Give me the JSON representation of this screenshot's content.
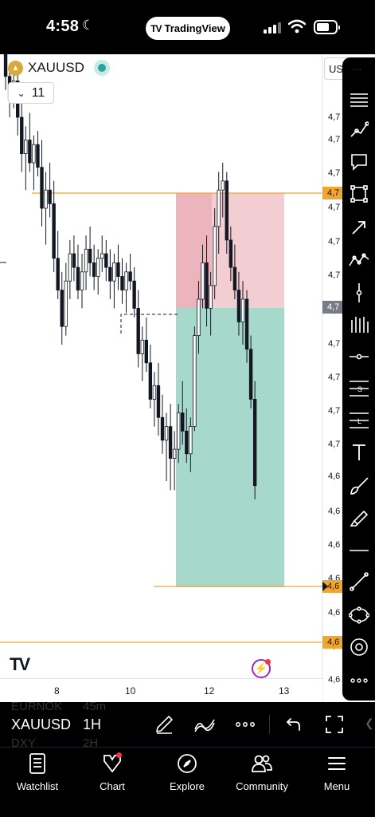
{
  "status_bar": {
    "time": "4:58",
    "app_pill": "TradingView"
  },
  "header": {
    "symbol": "XAUUSD",
    "indicator_count": "11",
    "currency_label": "USD"
  },
  "price_axis": {
    "labels": [
      "4,7",
      "4,7",
      "4,7",
      "4,7",
      "4,7",
      "4,7",
      "4,7",
      "4,7",
      "4,7",
      "4,7",
      "4,7",
      "4,6",
      "4,6",
      "4,6",
      "4,6",
      "4,6",
      "4,6",
      "4,6"
    ],
    "tags": [
      {
        "label": "4,7",
        "kind": "stop"
      },
      {
        "label": "4,7",
        "kind": "current"
      },
      {
        "label": "4,6",
        "kind": "target"
      },
      {
        "label": "4,6",
        "kind": "level"
      }
    ]
  },
  "time_axis": {
    "labels": [
      "8",
      "10",
      "12",
      "13"
    ]
  },
  "symbol_bar": {
    "symbol": "XAUUSD",
    "interval": "1H",
    "ghost_symbols": [
      "EURNOK",
      "DXY"
    ],
    "ghost_intervals": [
      "45m",
      "2H"
    ]
  },
  "nav": {
    "items": [
      {
        "label": "Watchlist",
        "icon": "watchlist-icon"
      },
      {
        "label": "Chart",
        "icon": "chart-icon"
      },
      {
        "label": "Explore",
        "icon": "compass-icon"
      },
      {
        "label": "Community",
        "icon": "community-icon"
      },
      {
        "label": "Menu",
        "icon": "menu-icon"
      }
    ]
  },
  "colors": {
    "up_candle": "#ffffff",
    "candle_border": "#131722",
    "stop_zone": "#f2cdd2",
    "target_zone": "#a6d8cc",
    "level_line": "#f0a730",
    "accent": "#2962ff"
  },
  "candles": [
    [
      0,
      80,
      82,
      74,
      76
    ],
    [
      1,
      75,
      76,
      66,
      69
    ],
    [
      2,
      69,
      71,
      60,
      64
    ],
    [
      3,
      64,
      70,
      62,
      68
    ],
    [
      4,
      68,
      72,
      56,
      60
    ],
    [
      5,
      60,
      64,
      48,
      52
    ],
    [
      6,
      52,
      58,
      44,
      55
    ],
    [
      7,
      55,
      61,
      48,
      50
    ],
    [
      8,
      50,
      56,
      44,
      54
    ],
    [
      9,
      54,
      57,
      47,
      49
    ],
    [
      10,
      49,
      55,
      36,
      40
    ],
    [
      11,
      40,
      48,
      32,
      44
    ],
    [
      12,
      44,
      50,
      38,
      41
    ],
    [
      13,
      41,
      46,
      26,
      29
    ],
    [
      14,
      29,
      35,
      20,
      22
    ],
    [
      15,
      22,
      26,
      10,
      14
    ],
    [
      16,
      14,
      28,
      12,
      24
    ],
    [
      17,
      24,
      33,
      20,
      30
    ],
    [
      18,
      30,
      34,
      24,
      27
    ],
    [
      19,
      27,
      32,
      20,
      22
    ],
    [
      20,
      22,
      30,
      18,
      26
    ],
    [
      21,
      26,
      34,
      22,
      31
    ],
    [
      22,
      31,
      36,
      25,
      28
    ],
    [
      23,
      28,
      32,
      22,
      25
    ],
    [
      24,
      25,
      31,
      21,
      29
    ],
    [
      25,
      29,
      34,
      26,
      30
    ],
    [
      26,
      30,
      33,
      24,
      27
    ],
    [
      27,
      27,
      31,
      20,
      24
    ],
    [
      28,
      24,
      30,
      18,
      28
    ],
    [
      29,
      28,
      32,
      22,
      25
    ],
    [
      30,
      25,
      29,
      19,
      22
    ],
    [
      31,
      22,
      28,
      17,
      26
    ],
    [
      32,
      26,
      30,
      22,
      24
    ],
    [
      33,
      24,
      27,
      16,
      18
    ],
    [
      34,
      18,
      22,
      5,
      8
    ],
    [
      35,
      8,
      14,
      2,
      11
    ],
    [
      36,
      11,
      16,
      4,
      6
    ],
    [
      37,
      6,
      10,
      -4,
      -2
    ],
    [
      38,
      -2,
      4,
      -8,
      1
    ],
    [
      39,
      1,
      6,
      -10,
      -6
    ],
    [
      40,
      -6,
      -1,
      -14,
      -11
    ],
    [
      41,
      -11,
      -5,
      -20,
      -8
    ],
    [
      42,
      -8,
      -3,
      -22,
      -15
    ],
    [
      43,
      -15,
      -9,
      -22,
      -13
    ],
    [
      44,
      -13,
      -3,
      -16,
      -5
    ],
    [
      45,
      -5,
      2,
      -12,
      -9
    ],
    [
      46,
      -9,
      -4,
      -16,
      -14
    ],
    [
      47,
      -14,
      -6,
      -18,
      -8
    ],
    [
      48,
      -8,
      14,
      -9,
      12
    ],
    [
      49,
      12,
      24,
      8,
      20
    ],
    [
      50,
      20,
      32,
      18,
      28
    ],
    [
      51,
      28,
      34,
      14,
      18
    ],
    [
      52,
      18,
      26,
      12,
      23
    ],
    [
      53,
      23,
      40,
      20,
      36
    ],
    [
      54,
      36,
      48,
      30,
      44
    ],
    [
      55,
      44,
      50,
      38,
      46
    ],
    [
      56,
      46,
      48,
      30,
      33
    ],
    [
      57,
      33,
      36,
      24,
      27
    ],
    [
      58,
      27,
      32,
      20,
      22
    ],
    [
      59,
      22,
      26,
      12,
      15
    ],
    [
      60,
      15,
      24,
      10,
      20
    ],
    [
      61,
      20,
      22,
      6,
      9
    ],
    [
      62,
      9,
      12,
      -4,
      -2
    ],
    [
      63,
      -2,
      2,
      -24,
      -21
    ]
  ]
}
